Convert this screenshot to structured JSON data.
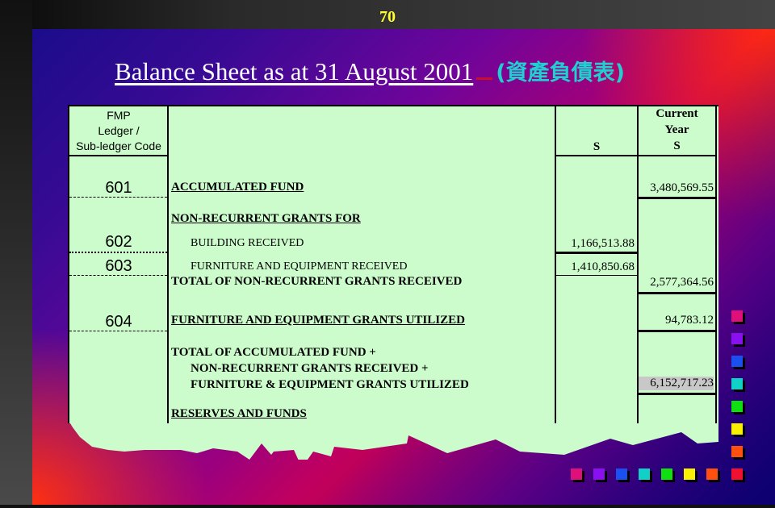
{
  "slide": {
    "number": "70",
    "title": "Balance Sheet as at 31 August 2001",
    "title_zh": "(資產負債表)"
  },
  "table": {
    "headers": {
      "code": [
        "FMP",
        "Ledger /",
        "Sub-ledger Code"
      ],
      "subtotal_currency": "S",
      "current_year": [
        "Current",
        "Year",
        "S"
      ]
    },
    "rows": [
      {
        "code": "601",
        "label": "ACCUMULATED FUND",
        "subtotal": "",
        "current_year": "3,480,569.55"
      },
      {
        "code": "",
        "label": "NON-RECURRENT GRANTS FOR",
        "subtotal": "",
        "current_year": ""
      },
      {
        "code": "602",
        "label": "BUILDING RECEIVED",
        "subtotal": "1,166,513.88",
        "current_year": ""
      },
      {
        "code": "603",
        "label": "FURNITURE AND EQUIPMENT RECEIVED",
        "subtotal": "1,410,850.68",
        "current_year": ""
      },
      {
        "code": "",
        "label": "TOTAL OF NON-RECURRENT GRANTS RECEIVED",
        "subtotal": "",
        "current_year": "2,577,364.56"
      },
      {
        "code": "604",
        "label": "FURNITURE AND EQUIPMENT GRANTS UTILIZED",
        "subtotal": "",
        "current_year": "94,783.12"
      },
      {
        "code": "",
        "label_lines": [
          "TOTAL OF ACCUMULATED FUND +",
          "NON-RECURRENT GRANTS RECEIVED +",
          "FURNITURE & EQUIPMENT GRANTS UTILIZED"
        ],
        "subtotal": "",
        "current_year": "6,152,717.23",
        "highlighted": true
      },
      {
        "code": "",
        "label": "RESERVES AND FUNDS",
        "subtotal": "",
        "current_year": ""
      }
    ]
  },
  "decor": {
    "square_colors": [
      "#e0107a",
      "#8a10f0",
      "#1a50f0",
      "#10d0c8",
      "#10e010",
      "#f8f000",
      "#ff5010",
      "#f01030"
    ]
  }
}
